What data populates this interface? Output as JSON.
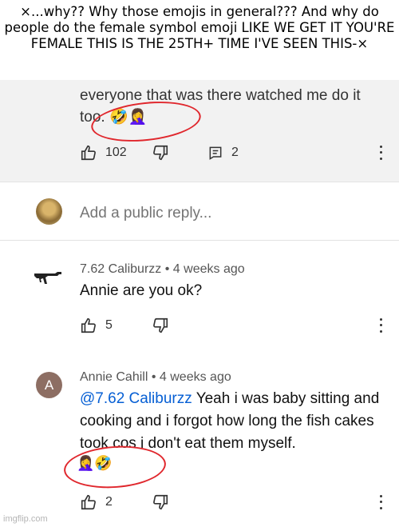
{
  "caption": "×...why?? Why those emojis in general??? And why do people do the female symbol emoji LIKE WE GET IT YOU'RE FEMALE THIS IS THE 25TH+ TIME I'VE SEEN THIS-×",
  "parent_comment": {
    "text": "everyone that was there watched me do it too.",
    "emojis": "🤣🤦‍♀️",
    "likes": "102",
    "replies": "2"
  },
  "reply_box": {
    "placeholder": "Add a public reply..."
  },
  "comments": [
    {
      "author": "7.62 Caliburzz",
      "time": "4 weeks ago",
      "text": "Annie are you ok?",
      "likes": "5"
    },
    {
      "author": "Annie Cahill",
      "time": "4 weeks ago",
      "avatar_letter": "A",
      "avatar_color": "#8d6e63",
      "mention": "@7.62 Caliburzz",
      "text": "Yeah i was baby sitting and cooking and i forgot how long the fish cakes took cos i don't eat them myself.",
      "emojis": "🤦‍♀️🤣",
      "likes": "2"
    }
  ],
  "separator": "•",
  "watermark": "imgflip.com"
}
